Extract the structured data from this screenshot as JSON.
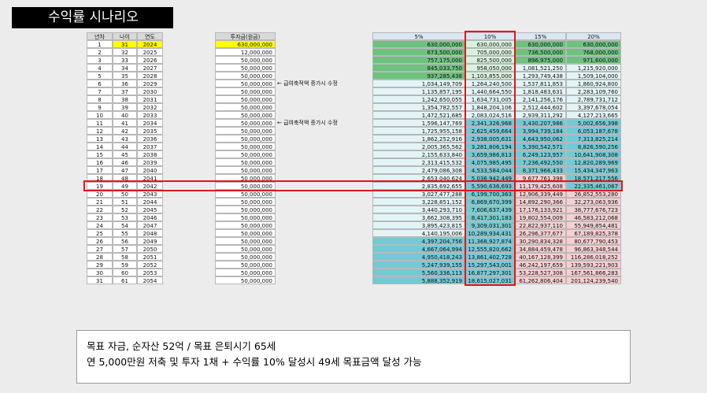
{
  "title": "수익률 시나리오",
  "table": {
    "headers": {
      "year_no": "년차",
      "age": "나이",
      "year": "연도",
      "invest": "투자금(원금)",
      "r5": "5%",
      "r10": "10%",
      "r15": "15%",
      "r20": "20%"
    },
    "notes": [
      {
        "row": 6,
        "text": "← 급여축적액 증가시 수정"
      },
      {
        "row": 11,
        "text": "← 급여축적액 증가시 수정"
      }
    ],
    "highlight_row": 19,
    "highlight_column": "10%",
    "rows": [
      [
        "1",
        "31",
        "2024",
        "630,000,000",
        "630,000,000",
        "630,000,000",
        "630,000,000",
        "630,000,000"
      ],
      [
        "2",
        "32",
        "2025",
        "12,000,000",
        "673,500,000",
        "705,000,000",
        "736,500,000",
        "768,000,000"
      ],
      [
        "3",
        "33",
        "2026",
        "50,000,000",
        "757,175,000",
        "825,500,000",
        "896,975,000",
        "971,600,000"
      ],
      [
        "4",
        "34",
        "2027",
        "50,000,000",
        "845,033,750",
        "958,050,000",
        "1,081,521,250",
        "1,215,920,000"
      ],
      [
        "5",
        "35",
        "2028",
        "50,000,000",
        "937,285,438",
        "1,103,855,000",
        "1,293,749,438",
        "1,509,104,000"
      ],
      [
        "6",
        "36",
        "2029",
        "50,000,000",
        "1,034,149,709",
        "1,264,240,500",
        "1,537,811,853",
        "1,860,924,800"
      ],
      [
        "7",
        "37",
        "2030",
        "50,000,000",
        "1,135,857,195",
        "1,440,664,550",
        "1,818,483,631",
        "2,283,109,760"
      ],
      [
        "8",
        "38",
        "2031",
        "50,000,000",
        "1,242,650,055",
        "1,634,731,005",
        "2,141,256,176",
        "2,789,731,712"
      ],
      [
        "9",
        "39",
        "2032",
        "50,000,000",
        "1,354,782,557",
        "1,848,204,106",
        "2,512,444,602",
        "3,397,678,054"
      ],
      [
        "10",
        "40",
        "2033",
        "50,000,000",
        "1,472,521,685",
        "2,083,024,516",
        "2,939,311,292",
        "4,127,213,665"
      ],
      [
        "11",
        "41",
        "2034",
        "50,000,000",
        "1,596,147,769",
        "2,341,326,968",
        "3,430,207,986",
        "5,002,656,398"
      ],
      [
        "12",
        "42",
        "2035",
        "50,000,000",
        "1,725,955,158",
        "2,625,459,664",
        "3,994,739,184",
        "6,053,187,678"
      ],
      [
        "13",
        "43",
        "2036",
        "50,000,000",
        "1,862,252,916",
        "2,938,005,631",
        "4,643,950,062",
        "7,313,825,214"
      ],
      [
        "14",
        "44",
        "2037",
        "50,000,000",
        "2,005,365,562",
        "3,281,806,194",
        "5,390,542,571",
        "8,826,590,256"
      ],
      [
        "15",
        "45",
        "2038",
        "50,000,000",
        "2,155,633,840",
        "3,659,986,813",
        "6,249,123,957",
        "10,641,908,308"
      ],
      [
        "16",
        "46",
        "2039",
        "50,000,000",
        "2,313,415,532",
        "4,075,985,495",
        "7,236,492,550",
        "12,820,289,969"
      ],
      [
        "17",
        "47",
        "2040",
        "50,000,000",
        "2,479,086,308",
        "4,533,584,044",
        "8,371,966,433",
        "15,434,347,963"
      ],
      [
        "18",
        "48",
        "2041",
        "50,000,000",
        "2,653,040,624",
        "5,036,942,449",
        "9,677,761,398",
        "18,571,217,556"
      ],
      [
        "19",
        "49",
        "2042",
        "50,000,000",
        "2,835,692,655",
        "5,590,636,693",
        "11,179,425,608",
        "22,335,461,067"
      ],
      [
        "20",
        "50",
        "2043",
        "50,000,000",
        "3,027,477,288",
        "6,199,700,363",
        "12,906,339,449",
        "26,852,553,280"
      ],
      [
        "21",
        "51",
        "2044",
        "50,000,000",
        "3,228,851,152",
        "6,869,670,399",
        "14,892,290,366",
        "32,273,063,936"
      ],
      [
        "22",
        "52",
        "2045",
        "50,000,000",
        "3,440,293,710",
        "7,606,637,439",
        "17,176,133,921",
        "38,777,676,723"
      ],
      [
        "23",
        "53",
        "2046",
        "50,000,000",
        "3,662,308,395",
        "8,417,301,183",
        "19,802,554,009",
        "46,583,212,068"
      ],
      [
        "24",
        "54",
        "2047",
        "50,000,000",
        "3,895,423,815",
        "9,309,031,301",
        "22,822,937,110",
        "55,949,854,481"
      ],
      [
        "25",
        "55",
        "2048",
        "50,000,000",
        "4,140,195,006",
        "10,289,934,431",
        "26,296,377,677",
        "67,189,825,378"
      ],
      [
        "26",
        "56",
        "2049",
        "50,000,000",
        "4,397,204,756",
        "11,368,927,874",
        "30,290,834,328",
        "80,677,790,453"
      ],
      [
        "27",
        "57",
        "2050",
        "50,000,000",
        "4,667,064,994",
        "12,555,820,662",
        "34,884,459,478",
        "96,863,348,544"
      ],
      [
        "28",
        "58",
        "2051",
        "50,000,000",
        "4,950,418,243",
        "13,861,402,728",
        "40,167,128,399",
        "116,286,018,252"
      ],
      [
        "29",
        "59",
        "2052",
        "50,000,000",
        "5,247,939,155",
        "15,297,543,001",
        "46,242,197,659",
        "139,593,221,903"
      ],
      [
        "30",
        "60",
        "2053",
        "50,000,000",
        "5,560,336,113",
        "16,877,297,301",
        "53,228,527,308",
        "167,561,866,283"
      ],
      [
        "31",
        "61",
        "2054",
        "50,000,000",
        "5,888,352,919",
        "18,615,027,031",
        "61,262,806,404",
        "201,124,239,540"
      ]
    ],
    "colors": {
      "yellow": "#ffff00",
      "green_dark": "#6cc27e",
      "green_light": "#d9f1dd",
      "teal_light": "#e3f4f6",
      "teal_dark": "#72cbd4",
      "pink": "#f6cfd1",
      "red_border": "#e0161d"
    }
  },
  "summary": {
    "line1": "목표 자금, 순자산 52억 / 목표 은퇴시기 65세",
    "line2": "연 5,000만원 저축 및 투자 1채 + 수익률 10% 달성시 49세 목표금액 달성 가능"
  }
}
